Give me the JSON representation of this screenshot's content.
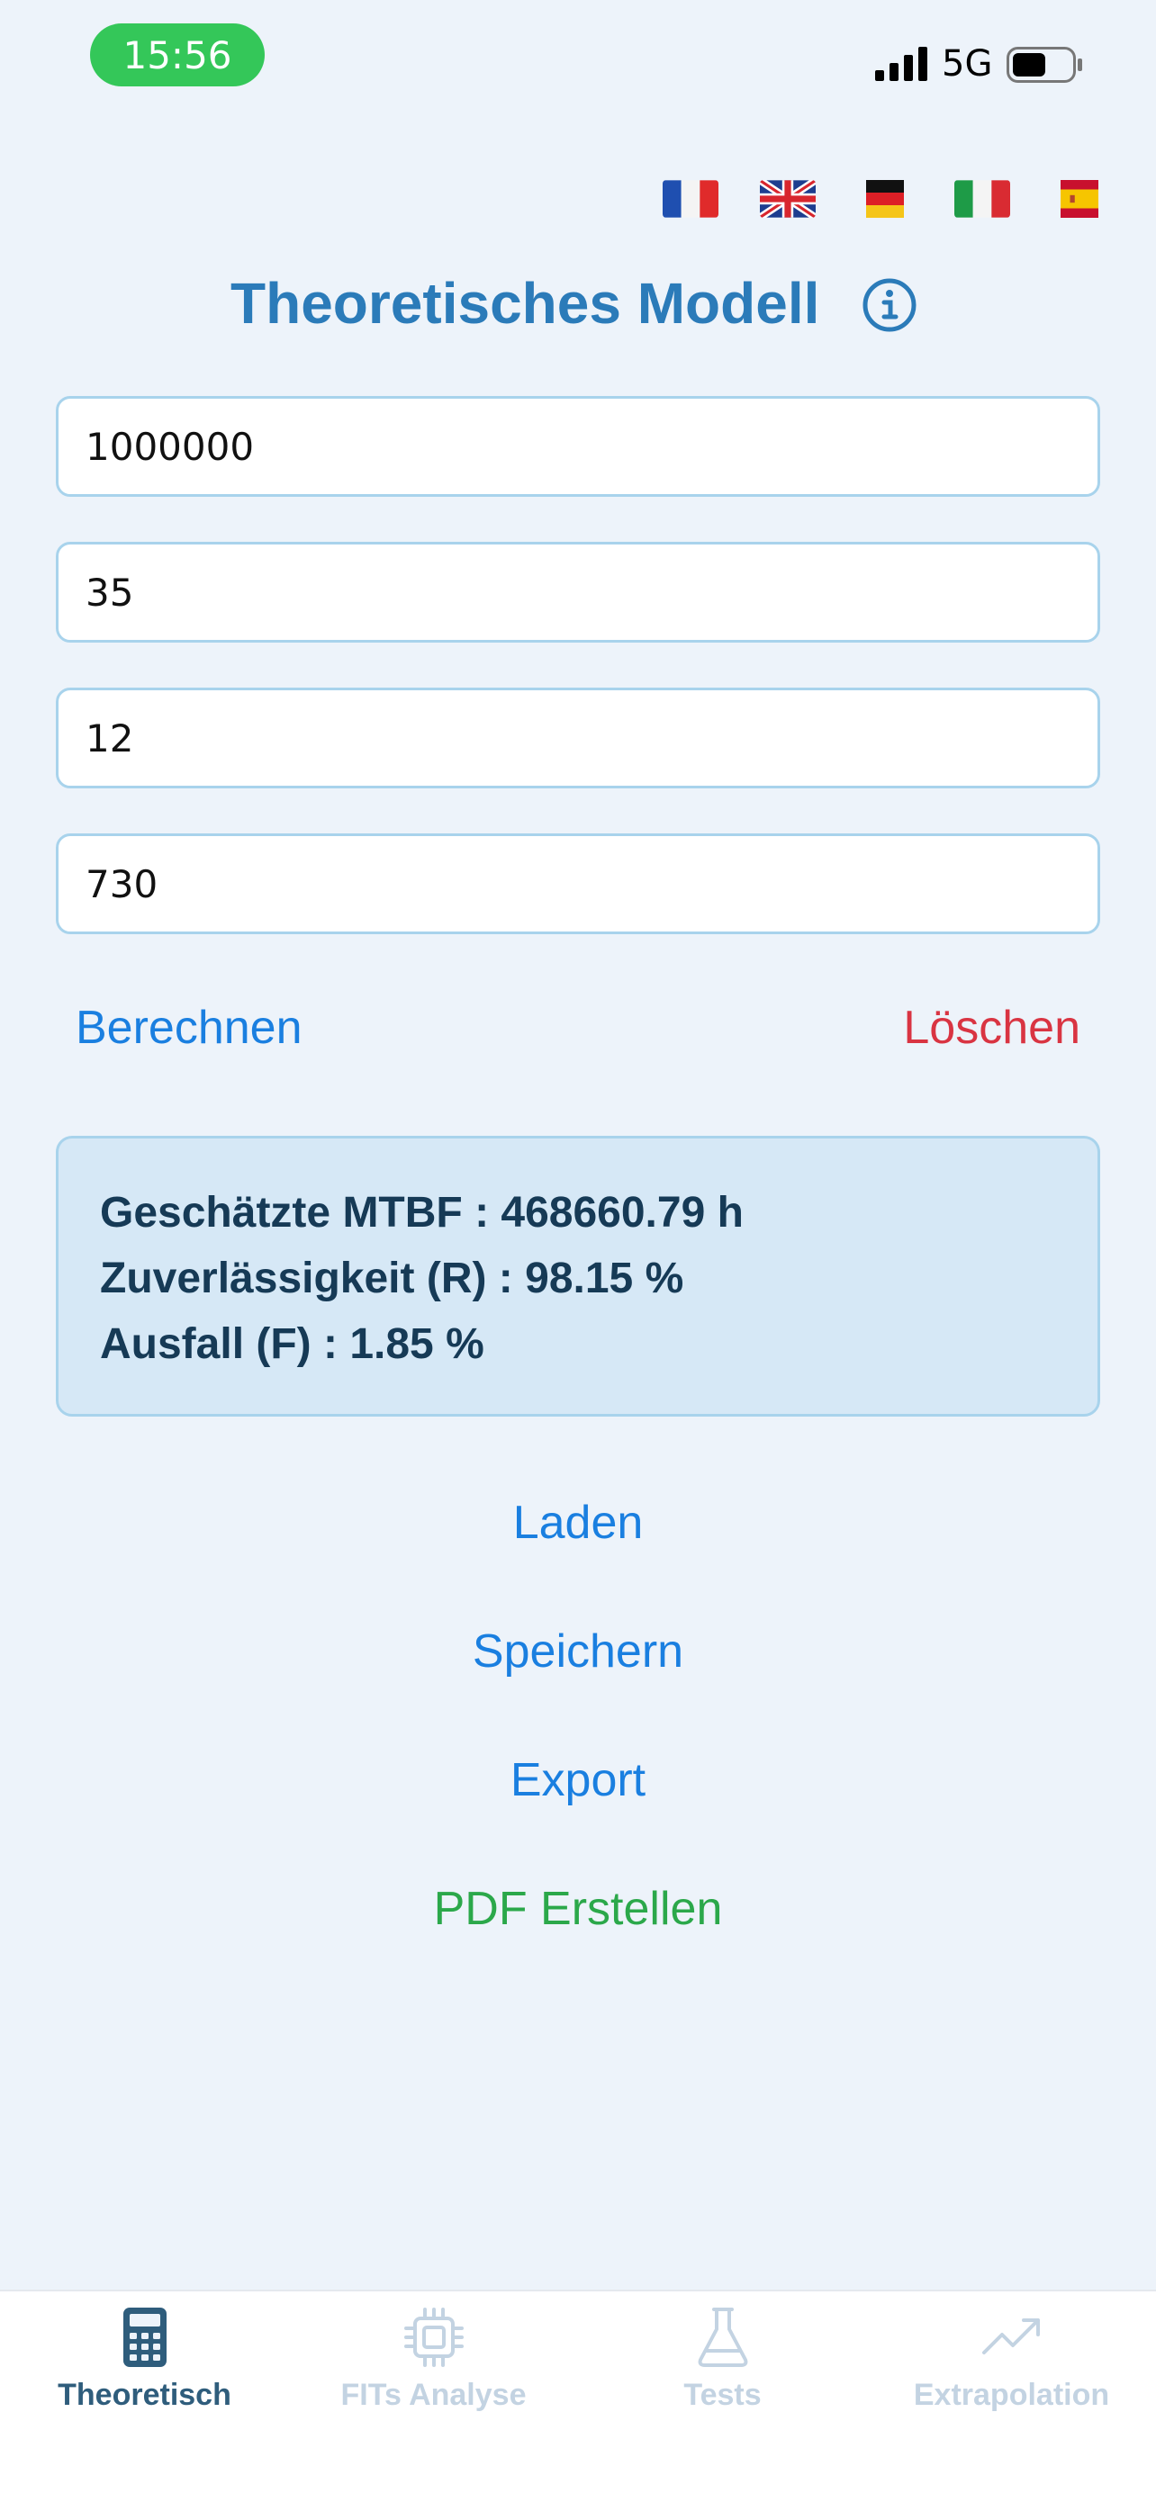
{
  "status_bar": {
    "time": "15:56",
    "network": "5G"
  },
  "languages": [
    "fr",
    "en",
    "de",
    "it",
    "es"
  ],
  "header": {
    "title": "Theoretisches Modell"
  },
  "inputs": [
    {
      "value": "1000000"
    },
    {
      "value": "35"
    },
    {
      "value": "12"
    },
    {
      "value": "730"
    }
  ],
  "actions": {
    "calculate": "Berechnen",
    "clear": "Löschen"
  },
  "results": {
    "mtbf": "Geschätzte MTBF : 468660.79 h",
    "reliability": "Zuverlässigkeit (R) : 98.15 %",
    "failure": "Ausfall (F) : 1.85 %"
  },
  "file_actions": {
    "load": "Laden",
    "save": "Speichern",
    "export": "Export",
    "pdf": "PDF Erstellen"
  },
  "tabs": [
    {
      "label": "Theoretisch",
      "icon": "calculator-icon",
      "active": true
    },
    {
      "label": "FITs Analyse",
      "icon": "chip-icon",
      "active": false
    },
    {
      "label": "Tests",
      "icon": "flask-icon",
      "active": false
    },
    {
      "label": "Extrapolation",
      "icon": "trend-up-icon",
      "active": false
    }
  ],
  "colors": {
    "background": "#EDF3FA",
    "title": "#2B7BB9",
    "link_blue": "#1A7FE0",
    "delete_red": "#D93442",
    "pdf_green": "#2BA84A",
    "result_bg": "#D6E8F6",
    "active_tab": "#2F5D7C",
    "inactive_tab": "#C3D3E2"
  }
}
